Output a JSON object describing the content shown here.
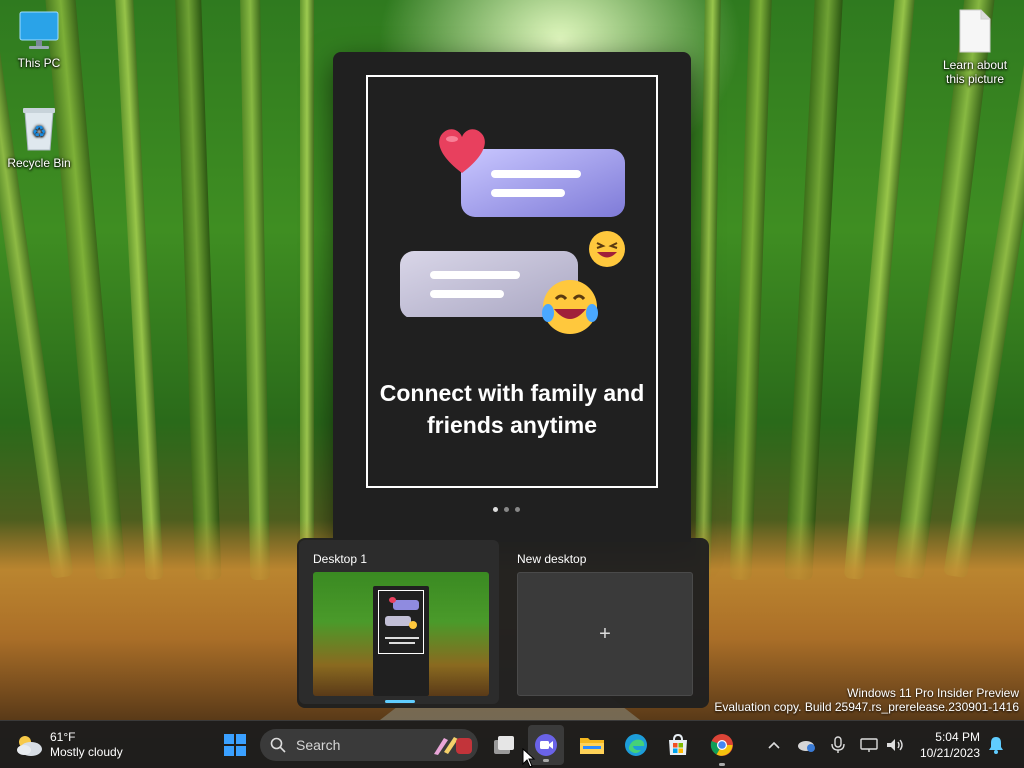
{
  "desktop": {
    "icons": [
      {
        "label": "This PC"
      },
      {
        "label": "Recycle Bin"
      },
      {
        "label": "Learn about this picture"
      }
    ]
  },
  "promo": {
    "title": "Connect with family and friends anytime",
    "page_index": 1,
    "page_count": 3
  },
  "task_view": {
    "desktops": [
      {
        "label": "Desktop 1",
        "selected": true
      },
      {
        "label": "New desktop",
        "selected": false
      }
    ],
    "new_desktop_plus": "+"
  },
  "watermark": {
    "line1": "Windows 11 Pro Insider Preview",
    "line2": "Evaluation copy. Build 25947.rs_prerelease.230901-1416"
  },
  "taskbar": {
    "weather": {
      "temp": "61°F",
      "condition": "Mostly cloudy"
    },
    "search": {
      "placeholder": "Search"
    },
    "apps": [
      "start-icon",
      "task-view-icon",
      "teams-meet-icon",
      "file-explorer-icon",
      "edge-icon",
      "microsoft-store-icon",
      "chrome-icon"
    ],
    "tray": [
      "chevron-up-icon",
      "onedrive-icon",
      "microphone-icon",
      "network-icon",
      "volume-icon",
      "notification-bell-icon"
    ],
    "clock": {
      "time": "5:04 PM",
      "date": "10/21/2023"
    }
  },
  "colors": {
    "accent": "#60cdff",
    "taskbar": "#1c1c1c",
    "panel": "#202020"
  }
}
